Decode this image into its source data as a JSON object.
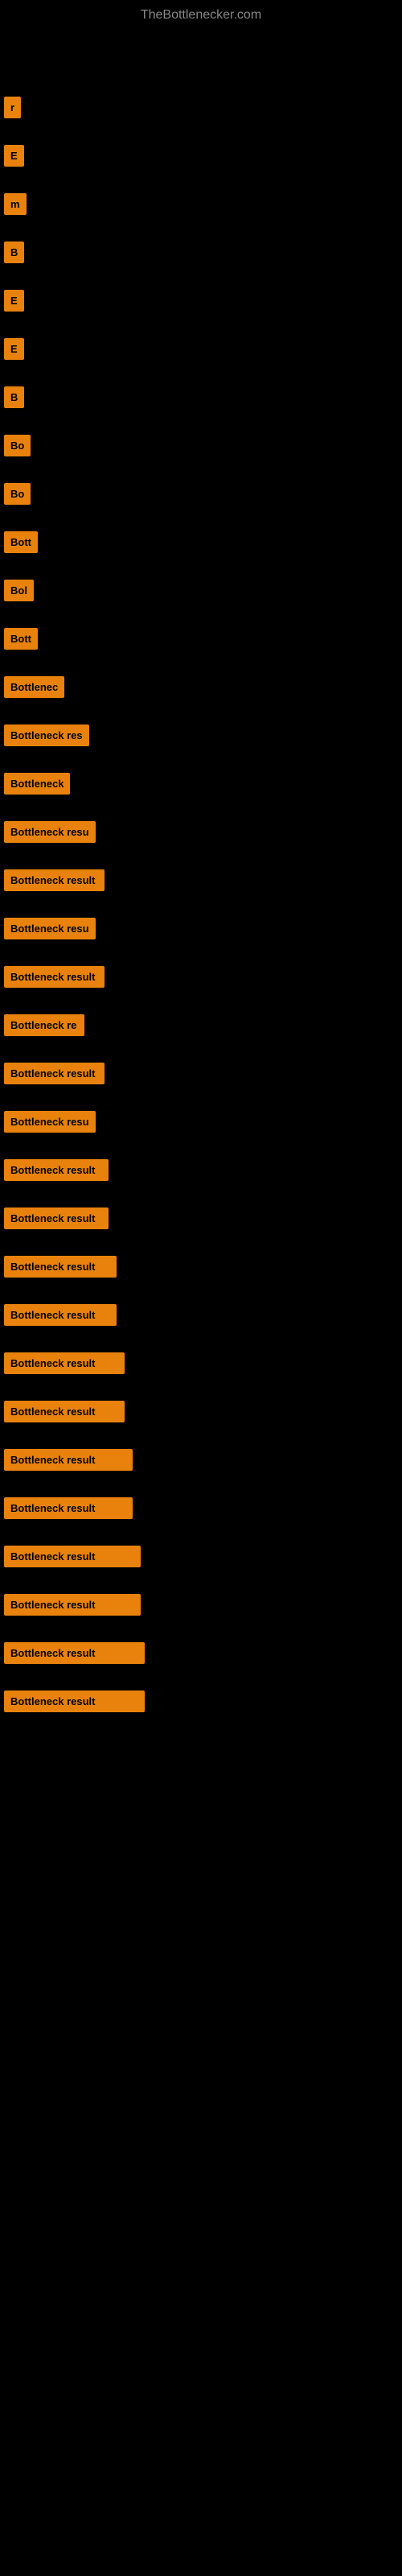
{
  "site": {
    "title": "TheBottlenecker.com"
  },
  "items": [
    {
      "label": "",
      "width": 2,
      "height": 30
    },
    {
      "label": "r",
      "width": 10,
      "height": 30
    },
    {
      "label": "E",
      "width": 12,
      "height": 30
    },
    {
      "label": "m",
      "width": 12,
      "height": 30
    },
    {
      "label": "B",
      "width": 12,
      "height": 30
    },
    {
      "label": "E",
      "width": 12,
      "height": 30
    },
    {
      "label": "E",
      "width": 12,
      "height": 30
    },
    {
      "label": "B",
      "width": 12,
      "height": 30
    },
    {
      "label": "Bo",
      "width": 22,
      "height": 30
    },
    {
      "label": "Bo",
      "width": 22,
      "height": 30
    },
    {
      "label": "Bott",
      "width": 35,
      "height": 30
    },
    {
      "label": "Bol",
      "width": 30,
      "height": 30
    },
    {
      "label": "Bott",
      "width": 35,
      "height": 30
    },
    {
      "label": "Bottlenec",
      "width": 75,
      "height": 30
    },
    {
      "label": "Bottleneck res",
      "width": 105,
      "height": 30
    },
    {
      "label": "Bottleneck",
      "width": 80,
      "height": 30
    },
    {
      "label": "Bottleneck resu",
      "width": 110,
      "height": 30
    },
    {
      "label": "Bottleneck result",
      "width": 125,
      "height": 30
    },
    {
      "label": "Bottleneck resu",
      "width": 110,
      "height": 30
    },
    {
      "label": "Bottleneck result",
      "width": 125,
      "height": 30
    },
    {
      "label": "Bottleneck re",
      "width": 100,
      "height": 30
    },
    {
      "label": "Bottleneck result",
      "width": 125,
      "height": 30
    },
    {
      "label": "Bottleneck resu",
      "width": 110,
      "height": 30
    },
    {
      "label": "Bottleneck result",
      "width": 130,
      "height": 30
    },
    {
      "label": "Bottleneck result",
      "width": 130,
      "height": 30
    },
    {
      "label": "Bottleneck result",
      "width": 140,
      "height": 30
    },
    {
      "label": "Bottleneck result",
      "width": 140,
      "height": 30
    },
    {
      "label": "Bottleneck result",
      "width": 150,
      "height": 30
    },
    {
      "label": "Bottleneck result",
      "width": 150,
      "height": 30
    },
    {
      "label": "Bottleneck result",
      "width": 160,
      "height": 30
    },
    {
      "label": "Bottleneck result",
      "width": 160,
      "height": 30
    },
    {
      "label": "Bottleneck result",
      "width": 170,
      "height": 30
    },
    {
      "label": "Bottleneck result",
      "width": 170,
      "height": 30
    },
    {
      "label": "Bottleneck result",
      "width": 175,
      "height": 30
    },
    {
      "label": "Bottleneck result",
      "width": 175,
      "height": 30
    }
  ]
}
